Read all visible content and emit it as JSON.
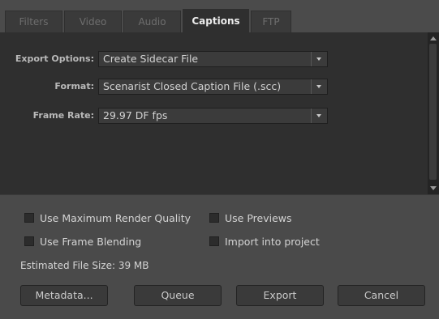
{
  "tabs": [
    {
      "label": "Filters",
      "active": false
    },
    {
      "label": "Video",
      "active": false
    },
    {
      "label": "Audio",
      "active": false
    },
    {
      "label": "Captions",
      "active": true
    },
    {
      "label": "FTP",
      "active": false
    }
  ],
  "fields": {
    "export_options": {
      "label": "Export Options:",
      "value": "Create Sidecar File"
    },
    "format": {
      "label": "Format:",
      "value": "Scenarist Closed Caption File (.scc)"
    },
    "frame_rate": {
      "label": "Frame Rate:",
      "value": "29.97 DF fps"
    }
  },
  "checkboxes": {
    "max_render_quality": {
      "label": "Use Maximum Render Quality",
      "checked": false
    },
    "use_previews": {
      "label": "Use Previews",
      "checked": false
    },
    "frame_blending": {
      "label": "Use Frame Blending",
      "checked": false
    },
    "import_into_project": {
      "label": "Import into project",
      "checked": false
    }
  },
  "file_size": "Estimated File Size:  39 MB",
  "buttons": {
    "metadata": "Metadata...",
    "queue": "Queue",
    "export": "Export",
    "cancel": "Cancel"
  }
}
